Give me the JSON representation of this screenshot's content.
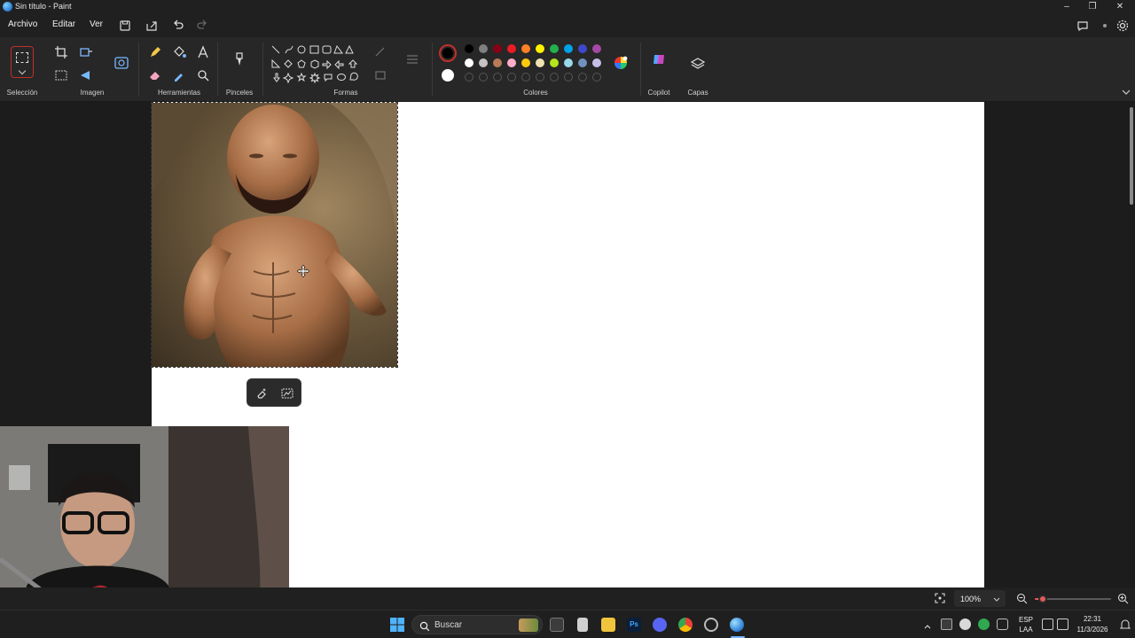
{
  "window": {
    "title": "Sin título - Paint"
  },
  "menu": {
    "file": "Archivo",
    "edit": "Editar",
    "view": "Ver"
  },
  "ribbon": {
    "groups": {
      "selection": "Selección",
      "image": "Imagen",
      "tools": "Herramientas",
      "brushes": "Pinceles",
      "shapes": "Formas",
      "colors": "Colores",
      "copilot": "Copilot",
      "layers": "Capas"
    },
    "colors": {
      "row1": [
        "#000000",
        "#7f7f7f",
        "#880015",
        "#ed1c24",
        "#ff7f27",
        "#fff200",
        "#22b14c",
        "#00a2e8",
        "#3f48cc",
        "#a349a4"
      ],
      "row2": [
        "#ffffff",
        "#c3c3c3",
        "#b97a57",
        "#ffaec9",
        "#ffc90e",
        "#efe4b0",
        "#b5e61d",
        "#99d9ea",
        "#7092be",
        "#c8bfe7"
      ],
      "primary": "#000000",
      "secondary": "#ffffff"
    }
  },
  "status": {
    "zoom": "100%",
    "zoom_fraction": 0.1
  },
  "taskbar": {
    "search_placeholder": "Buscar",
    "language": "ESP",
    "layout": "LAA",
    "time": "22:31",
    "date": "11/3/2026"
  }
}
